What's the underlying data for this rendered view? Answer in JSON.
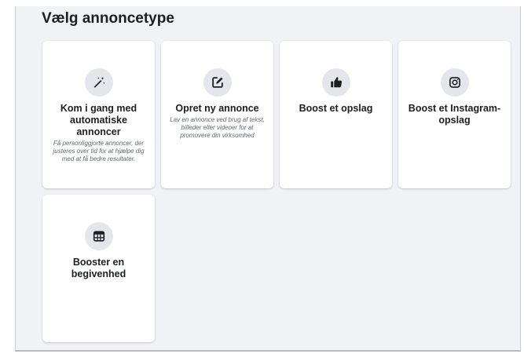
{
  "page": {
    "title": "Vælg annoncetype"
  },
  "cards": [
    {
      "icon": "magic-wand-icon",
      "title": "Kom i gang med automatiske annoncer",
      "description": "Få personliggjorte annoncer, der justeres over tid for at hjælpe dig med at få bedre resultater."
    },
    {
      "icon": "edit-icon",
      "title": "Opret ny annonce",
      "description": "Lav en annonce ved brug af tekst, billeder eller videoer for at promovere din virksomhed"
    },
    {
      "icon": "thumbs-up-icon",
      "title": "Boost et opslag",
      "description": ""
    },
    {
      "icon": "instagram-icon",
      "title": "Boost et Instagram-opslag",
      "description": ""
    },
    {
      "icon": "calendar-icon",
      "title": "Booster en begivenhed",
      "description": ""
    }
  ],
  "colors": {
    "background": "#f0f2f5",
    "card": "#ffffff",
    "icon_circle": "#e4e6eb",
    "text": "#1c1e21",
    "muted_text": "#606770"
  }
}
